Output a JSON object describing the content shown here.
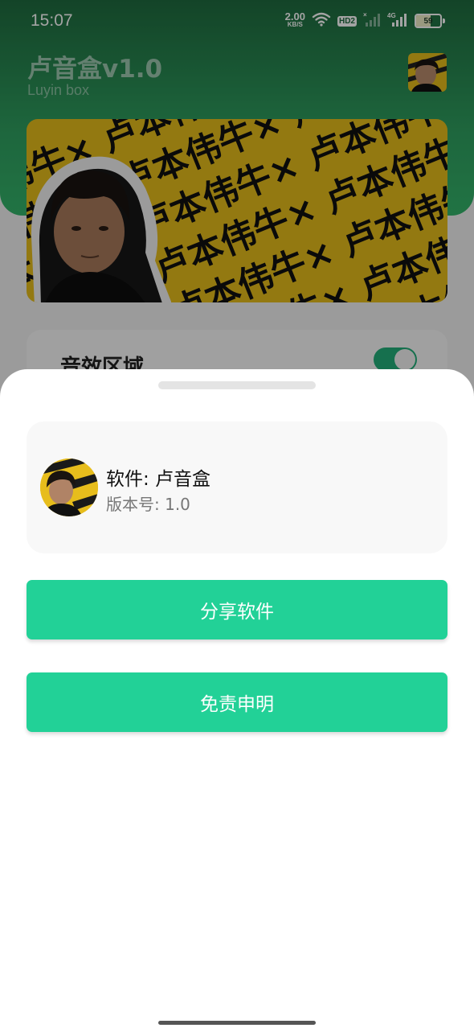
{
  "status_bar": {
    "time": "15:07",
    "net_speed_value": "2.00",
    "net_speed_unit": "KB/S",
    "hd_badge": "HD2",
    "network_label": "4G",
    "battery_level": "59",
    "battery_fraction": 0.59
  },
  "app": {
    "title": "卢音盒v1.0",
    "subtitle": "Luyin box",
    "banner_text": "卢本伟牛×",
    "effects_label": "音效区域",
    "effects_enabled": true
  },
  "sheet": {
    "software_name": "软件: 卢音盒",
    "version": "版本号: 1.0",
    "share_button": "分享软件",
    "disclaimer_button": "免责申明"
  },
  "colors": {
    "accent": "#22d197",
    "header_green": "#2fa060",
    "banner_yellow": "#e7bd1c"
  }
}
